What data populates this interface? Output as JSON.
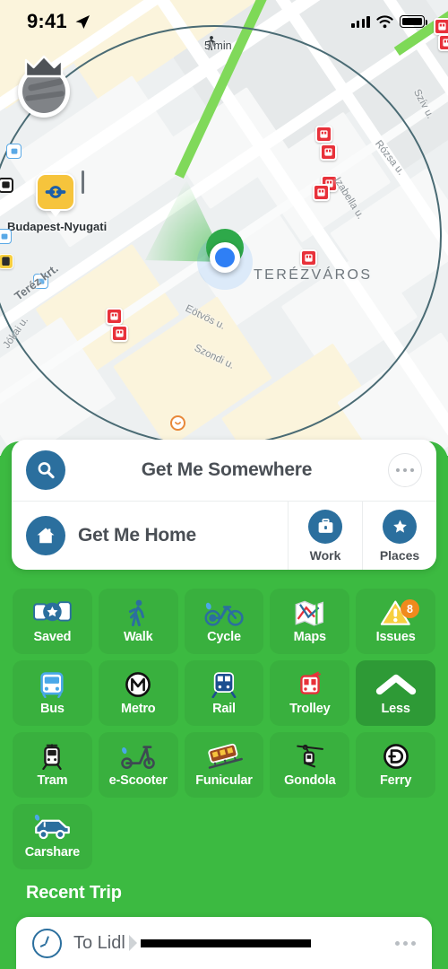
{
  "status_bar": {
    "time": "9:41",
    "location_arrow_icon": "location-arrow-icon",
    "signal_icon": "signal-bars-icon",
    "wifi_icon": "wifi-icon",
    "battery_icon": "battery-icon"
  },
  "map": {
    "walk_time_label": "5 min",
    "walk_icon": "walking-person-icon",
    "district_label": "TERÉZVÁROS",
    "station_label": "Budapest-Nyugati",
    "station_icon": "train-station-icon",
    "avatar_icon": "crown-avatar-icon",
    "current_location_icon": "current-location-dot",
    "streets": [
      {
        "name": "Szív u."
      },
      {
        "name": "Rózsa u."
      },
      {
        "name": "Izabella u."
      },
      {
        "name": "Eötvös u."
      },
      {
        "name": "Szondi u."
      },
      {
        "name": "Teréz krt."
      },
      {
        "name": "Jókai u."
      }
    ]
  },
  "search_card": {
    "search_icon": "search-icon",
    "somewhere_label": "Get Me Somewhere",
    "overflow_icon": "more-options-icon",
    "home_icon": "home-icon",
    "home_label": "Get Me Home",
    "quick_actions": [
      {
        "label": "Work",
        "icon": "briefcase-icon"
      },
      {
        "label": "Places",
        "icon": "star-icon"
      }
    ]
  },
  "tiles": [
    {
      "label": "Saved",
      "icon": "saved-transit-star-icon",
      "dark": false
    },
    {
      "label": "Walk",
      "icon": "walk-icon",
      "dark": false
    },
    {
      "label": "Cycle",
      "icon": "bicycle-icon",
      "dark": false
    },
    {
      "label": "Maps",
      "icon": "maps-icon",
      "dark": false
    },
    {
      "label": "Issues",
      "icon": "warning-triangle-icon",
      "dark": false,
      "badge": "8"
    },
    {
      "label": "Bus",
      "icon": "bus-icon",
      "dark": false
    },
    {
      "label": "Metro",
      "icon": "metro-m-icon",
      "dark": false
    },
    {
      "label": "Rail",
      "icon": "rail-icon",
      "dark": false
    },
    {
      "label": "Trolley",
      "icon": "trolleybus-icon",
      "dark": false
    },
    {
      "label": "Less",
      "icon": "chevron-up-icon",
      "dark": true
    },
    {
      "label": "Tram",
      "icon": "tram-icon",
      "dark": false
    },
    {
      "label": "e-Scooter",
      "icon": "escooter-icon",
      "dark": false
    },
    {
      "label": "Funicular",
      "icon": "funicular-icon",
      "dark": false
    },
    {
      "label": "Gondola",
      "icon": "gondola-icon",
      "dark": false
    },
    {
      "label": "Ferry",
      "icon": "ferry-d-icon",
      "dark": false
    },
    {
      "label": "Carshare",
      "icon": "carshare-icon",
      "dark": false
    }
  ],
  "recent": {
    "section_title": "Recent Trip",
    "clock_icon": "clock-icon",
    "trip_label": "To Lidl",
    "trip_destination_redacted": true,
    "overflow_icon": "more-options-icon"
  },
  "colors": {
    "brand_green": "#3cba41",
    "tile_green": "#39b03e",
    "tile_green_dark": "#2e9a36",
    "accent_blue": "#2b6f9e",
    "badge_orange": "#f08a1d",
    "pin_red": "#e8313a",
    "station_yellow": "#f6c43c"
  }
}
